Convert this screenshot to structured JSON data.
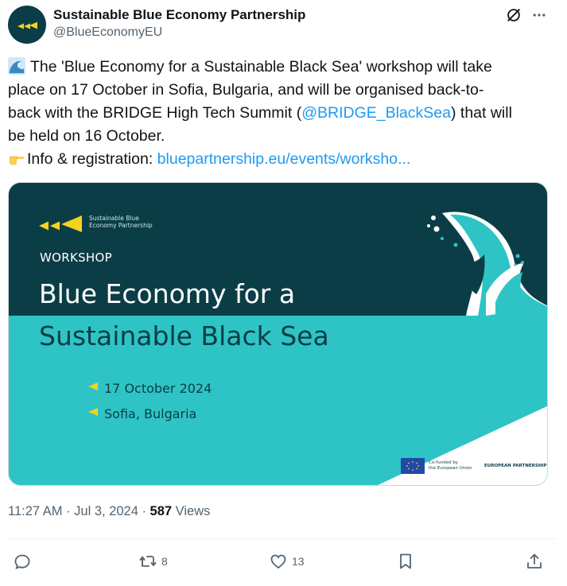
{
  "author": {
    "name": "Sustainable Blue Economy Partnership",
    "handle": "@BlueEconomyEU"
  },
  "icons": {
    "grok": "grok-icon",
    "more": "more-icon",
    "wave": "wave-emoji",
    "pointing": "pointing-hand-emoji"
  },
  "tweet": {
    "line1": "The 'Blue Economy for a Sustainable Black Sea' workshop will take",
    "line2": "place on 17 October in Sofia, Bulgaria, and will be organised back-to-",
    "line3_pre": "back with the BRIDGE High Tech Summit (",
    "mention": "@BRIDGE_BlackSea",
    "line3_post": ") that will",
    "line4": "be held on 16 October.",
    "info_label": "Info & registration: ",
    "info_link": "bluepartnership.eu/events/worksho..."
  },
  "media": {
    "logo_line1": "Sustainable Blue",
    "logo_line2": "Economy Partnership",
    "label": "WORKSHOP",
    "title_line1": "Blue Economy for a",
    "title_line2": "Sustainable Black Sea",
    "date": "17 October 2024",
    "location": "Sofia, Bulgaria",
    "eu_line1": "Co-funded by",
    "eu_line2": "the European Union",
    "partnership": "EUROPEAN PARTNERSHIP",
    "colors": {
      "dark": "#0b3d46",
      "teal": "#2ec4c6",
      "accent": "#f4d21f"
    }
  },
  "meta": {
    "time": "11:27 AM · Jul 3, 2024 · ",
    "views_count": "587",
    "views_label": " Views"
  },
  "actions": {
    "reply_count": "",
    "retweet_count": "8",
    "like_count": "13"
  }
}
